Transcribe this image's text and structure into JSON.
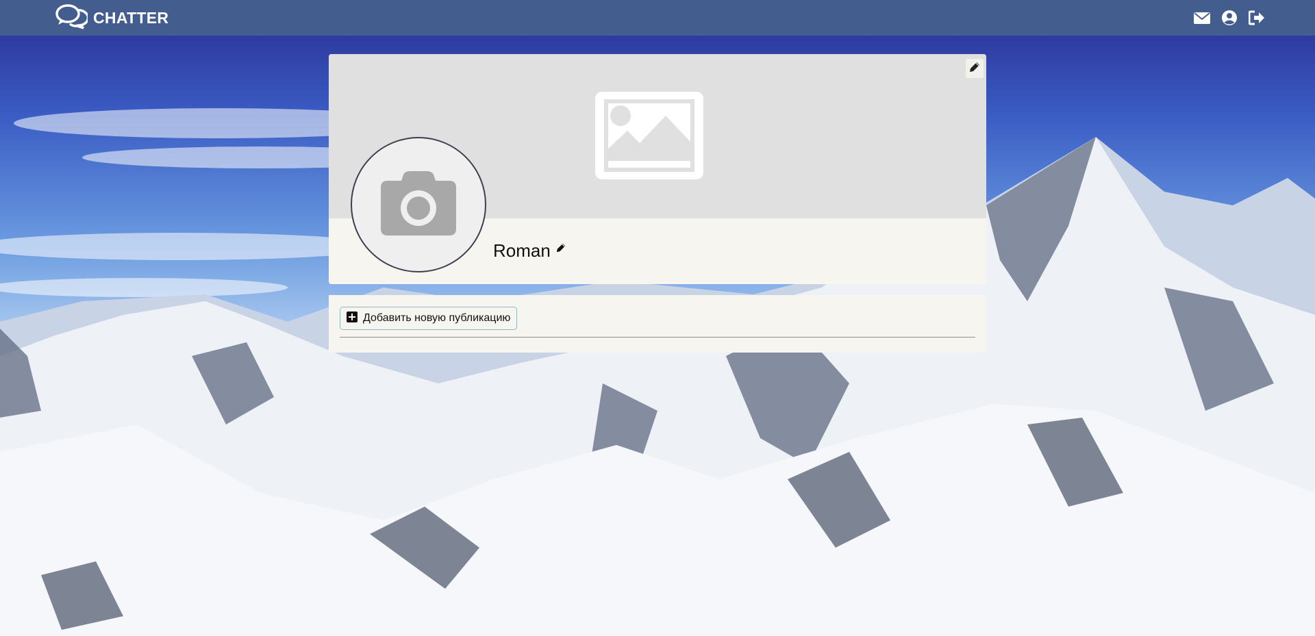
{
  "app": {
    "brand": "CHATTER"
  },
  "nav": {
    "icons": [
      "envelope-icon",
      "user-circle-icon",
      "sign-out-icon"
    ]
  },
  "profile": {
    "name": "Roman",
    "cover_icon": "image-placeholder-icon",
    "avatar_icon": "camera-icon"
  },
  "posts": {
    "add_label": "Добавить новую публикацию"
  },
  "colors": {
    "navbar": "#445d8f",
    "card_bg": "#f7f5ef",
    "cover_bg": "#e0e0e0",
    "button_border": "#8fb6c7"
  }
}
